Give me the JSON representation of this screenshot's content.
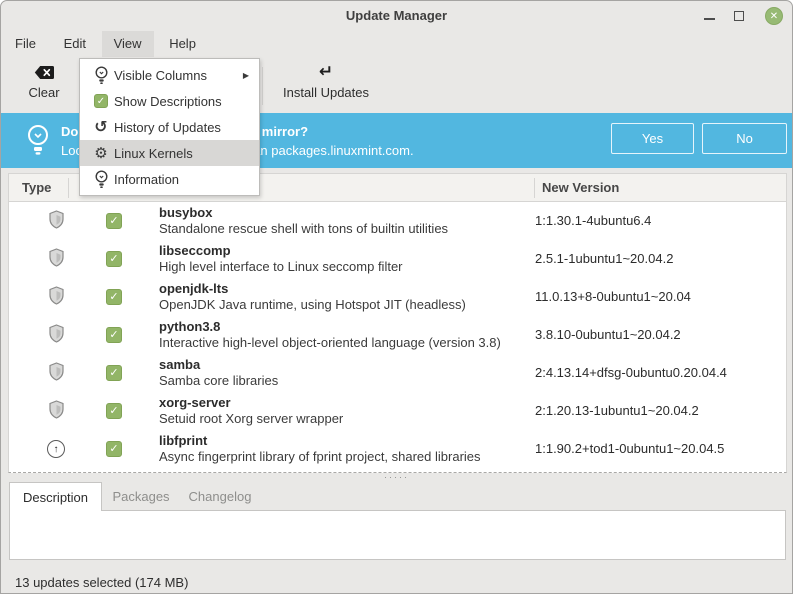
{
  "window": {
    "title": "Update Manager"
  },
  "titlebar": {
    "close_glyph": "✕"
  },
  "menubar": {
    "items": [
      {
        "label": "File"
      },
      {
        "label": "Edit"
      },
      {
        "label": "View",
        "active": true
      },
      {
        "label": "Help"
      }
    ]
  },
  "view_menu": {
    "items": [
      {
        "label": "Visible Columns",
        "icon": "lightbulb-icon",
        "submenu": true
      },
      {
        "label": "Show Descriptions",
        "icon": "checkbox-checked-icon",
        "checked": true
      },
      {
        "label": "History of Updates",
        "icon": "history-icon"
      },
      {
        "label": "Linux Kernels",
        "icon": "gears-icon",
        "highlighted": true
      },
      {
        "label": "Information",
        "icon": "lightbulb-icon"
      }
    ]
  },
  "toolbar": {
    "clear_label": "Clear",
    "install_label": "Install Updates"
  },
  "banner": {
    "question": "Do you want to switch to a local mirror?",
    "detail": "Local mirrors are usually faster than packages.linuxmint.com.",
    "yes_label": "Yes",
    "no_label": "No"
  },
  "table": {
    "headers": {
      "type": "Type",
      "new_version": "New Version"
    },
    "rows": [
      {
        "type_icon": "shield-icon",
        "checked": true,
        "name": "busybox",
        "description": "Standalone rescue shell with tons of builtin utilities",
        "new_version": "1:1.30.1-4ubuntu6.4"
      },
      {
        "type_icon": "shield-icon",
        "checked": true,
        "name": "libseccomp",
        "description": "High level interface to Linux seccomp filter",
        "new_version": "2.5.1-1ubuntu1~20.04.2"
      },
      {
        "type_icon": "shield-icon",
        "checked": true,
        "name": "openjdk-lts",
        "description": "OpenJDK Java runtime, using Hotspot JIT (headless)",
        "new_version": "11.0.13+8-0ubuntu1~20.04"
      },
      {
        "type_icon": "shield-icon",
        "checked": true,
        "name": "python3.8",
        "description": "Interactive high-level object-oriented language (version 3.8)",
        "new_version": "3.8.10-0ubuntu1~20.04.2"
      },
      {
        "type_icon": "shield-icon",
        "checked": true,
        "name": "samba",
        "description": "Samba core libraries",
        "new_version": "2:4.13.14+dfsg-0ubuntu0.20.04.4"
      },
      {
        "type_icon": "shield-icon",
        "checked": true,
        "name": "xorg-server",
        "description": "Setuid root Xorg server wrapper",
        "new_version": "2:1.20.13-1ubuntu1~20.04.2"
      },
      {
        "type_icon": "upgrade-icon",
        "checked": true,
        "name": "libfprint",
        "description": "Async fingerprint library of fprint project, shared libraries",
        "new_version": "1:1.90.2+tod1-0ubuntu1~20.04.5"
      }
    ]
  },
  "tabs": [
    {
      "label": "Description",
      "active": true
    },
    {
      "label": "Packages"
    },
    {
      "label": "Changelog"
    }
  ],
  "statusbar": {
    "text": "13 updates selected (174 MB)"
  },
  "icons": {
    "check": "✓",
    "history_arrow": "↺",
    "gears": "⚙",
    "submenu_arrow": "▶",
    "return_arrow": "↵",
    "up_arrow": "↑"
  },
  "colors": {
    "banner_blue": "#52b7e0",
    "mint_green": "#92b567",
    "close_green": "#97ba74"
  }
}
